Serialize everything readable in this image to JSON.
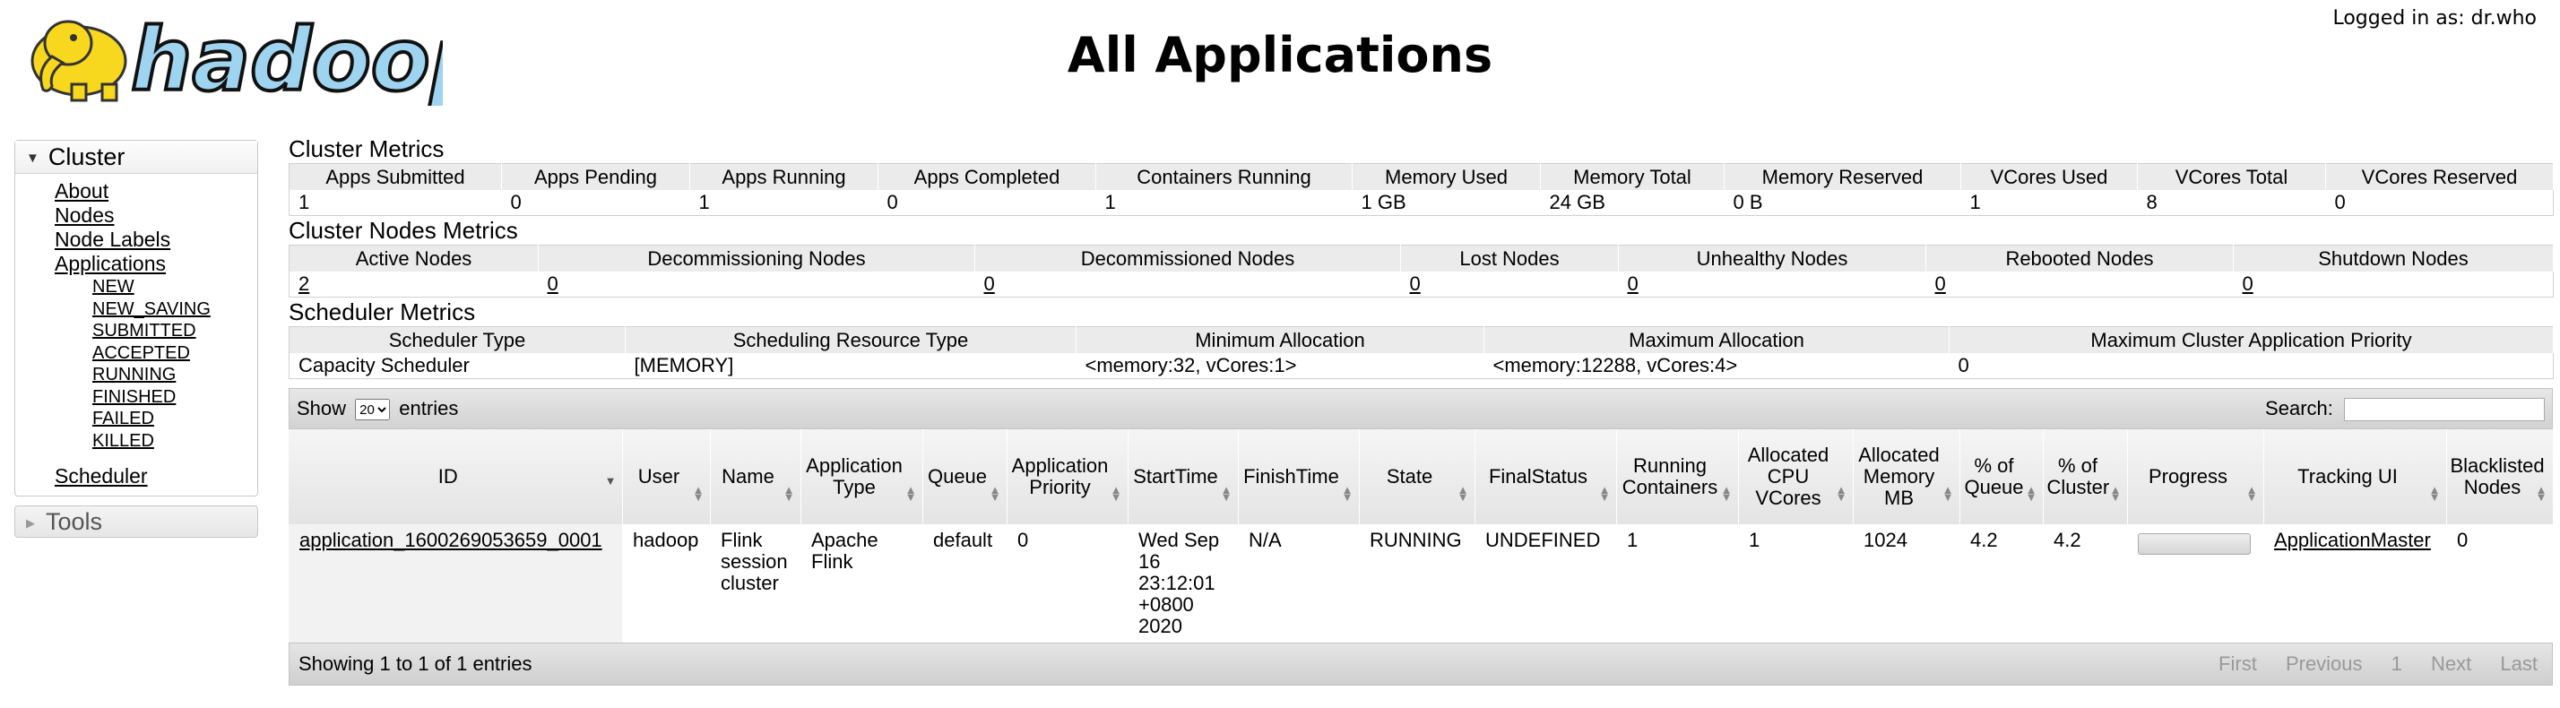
{
  "header": {
    "logo_text": "hadoop",
    "title": "All Applications",
    "user": "Logged in as: dr.who"
  },
  "nav": {
    "cluster_label": "Cluster",
    "links": [
      "About",
      "Nodes",
      "Node Labels",
      "Applications"
    ],
    "states": [
      "NEW",
      "NEW_SAVING",
      "SUBMITTED",
      "ACCEPTED",
      "RUNNING",
      "FINISHED",
      "FAILED",
      "KILLED"
    ],
    "scheduler": "Scheduler",
    "tools_label": "Tools"
  },
  "cluster_metrics": {
    "title": "Cluster Metrics",
    "headers": [
      "Apps Submitted",
      "Apps Pending",
      "Apps Running",
      "Apps Completed",
      "Containers Running",
      "Memory Used",
      "Memory Total",
      "Memory Reserved",
      "VCores Used",
      "VCores Total",
      "VCores Reserved"
    ],
    "values": [
      "1",
      "0",
      "1",
      "0",
      "1",
      "1 GB",
      "24 GB",
      "0 B",
      "1",
      "8",
      "0"
    ]
  },
  "node_metrics": {
    "title": "Cluster Nodes Metrics",
    "headers": [
      "Active Nodes",
      "Decommissioning Nodes",
      "Decommissioned Nodes",
      "Lost Nodes",
      "Unhealthy Nodes",
      "Rebooted Nodes",
      "Shutdown Nodes"
    ],
    "values": [
      "2",
      "0",
      "0",
      "0",
      "0",
      "0",
      "0"
    ]
  },
  "scheduler_metrics": {
    "title": "Scheduler Metrics",
    "headers": [
      "Scheduler Type",
      "Scheduling Resource Type",
      "Minimum Allocation",
      "Maximum Allocation",
      "Maximum Cluster Application Priority"
    ],
    "values": [
      "Capacity Scheduler",
      "[MEMORY]",
      "<memory:32, vCores:1>",
      "<memory:12288, vCores:4>",
      "0"
    ]
  },
  "apps_table": {
    "show_label": "Show",
    "page_size": "20",
    "entries_label": "entries",
    "search_label": "Search:",
    "search_value": "",
    "headers": [
      "ID",
      "User",
      "Name",
      "Application Type",
      "Queue",
      "Application Priority",
      "StartTime",
      "FinishTime",
      "State",
      "FinalStatus",
      "Running Containers",
      "Allocated CPU VCores",
      "Allocated Memory MB",
      "% of Queue",
      "% of Cluster",
      "Progress",
      "Tracking UI",
      "Blacklisted Nodes"
    ],
    "rows": [
      {
        "id": "application_1600269053659_0001",
        "user": "hadoop",
        "name": "Flink session cluster",
        "type": "Apache Flink",
        "queue": "default",
        "priority": "0",
        "start_time": "Wed Sep 16 23:12:01 +0800 2020",
        "finish_time": "N/A",
        "state": "RUNNING",
        "final_status": "UNDEFINED",
        "running_containers": "1",
        "cpu_vcores": "1",
        "memory_mb": "1024",
        "pct_queue": "4.2",
        "pct_cluster": "4.2",
        "progress": 0,
        "tracking_ui": "ApplicationMaster",
        "blacklisted": "0"
      }
    ],
    "info": "Showing 1 to 1 of 1 entries",
    "pager": [
      "First",
      "Previous",
      "1",
      "Next",
      "Last"
    ]
  }
}
